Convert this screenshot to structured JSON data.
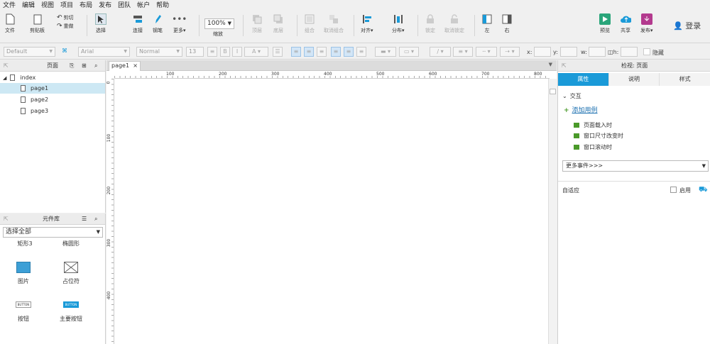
{
  "menu": [
    "文件",
    "编辑",
    "视图",
    "项目",
    "布局",
    "发布",
    "团队",
    "帐户",
    "帮助"
  ],
  "toolbar": {
    "file": "文件",
    "clipboard": "剪贴板",
    "cut": "剪切",
    "copy": "复制",
    "undo": "撤销",
    "redo": "重做",
    "select": "选择",
    "connect": "连接",
    "pen": "钢笔",
    "more": "更多▾",
    "zoom_value": "100%",
    "zoom_label": "缩放",
    "top": "顶层",
    "bottom": "底层",
    "group": "组合",
    "ungroup": "取消组合",
    "align": "对齐▾",
    "distribute": "分布▾",
    "lock": "锁定",
    "unlock": "取消锁定",
    "left": "左",
    "right": "右",
    "preview": "预览",
    "share": "共享",
    "publish": "发布▾",
    "login": "登录"
  },
  "format": {
    "style": "Default",
    "font": "Arial",
    "weight": "Normal",
    "size": "13",
    "x_label": "x:",
    "y_label": "y:",
    "w_label": "w:",
    "h_label": "h:",
    "hidden": "隐藏"
  },
  "pages_panel": {
    "title": "页面",
    "items": [
      "index",
      "page1",
      "page2",
      "page3"
    ]
  },
  "library": {
    "title": "元件库",
    "select": "选择全部",
    "widgets": [
      "矩形3",
      "椭圆形",
      "图片",
      "占位符",
      "按钮",
      "主要按钮"
    ],
    "button_text": "BUTTON"
  },
  "canvas": {
    "tab": "page1",
    "ruler_h": [
      "100",
      "200",
      "300",
      "400",
      "500",
      "600",
      "700",
      "800"
    ],
    "ruler_v": [
      "0",
      "100",
      "200",
      "300",
      "400"
    ]
  },
  "inspector": {
    "title": "检视: 页面",
    "tabs": [
      "属性",
      "说明",
      "样式"
    ],
    "interaction": "交互",
    "add_case": "添加用例",
    "events": [
      "页面载入时",
      "窗口尺寸改变时",
      "窗口滚动时"
    ],
    "more_events": "更多事件>>>",
    "adaptive": "自适应",
    "enable": "启用"
  },
  "colors": {
    "accent": "#1a9ad8",
    "green": "#4a9a2a"
  }
}
